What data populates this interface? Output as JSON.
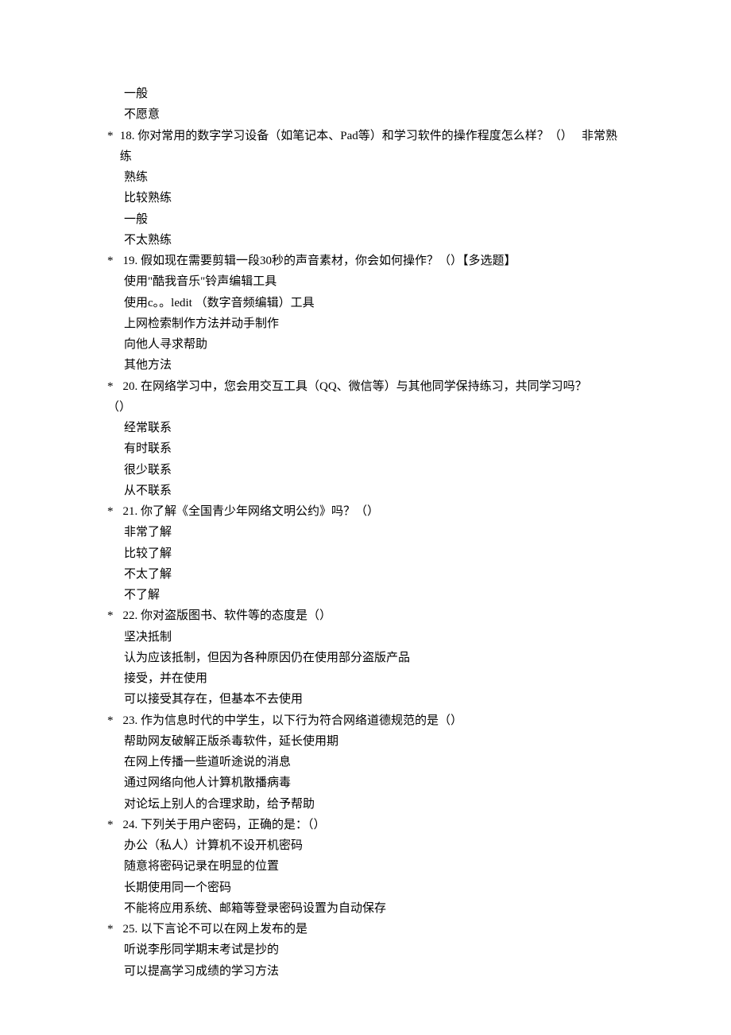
{
  "orphan_options": [
    "一般",
    "不愿意"
  ],
  "questions": [
    {
      "num": "18.",
      "text": "你对常用的数字学习设备（如笔记本、Pad等）和学习软件的操作程度怎么样？（）",
      "inline_option": "非常熟练",
      "options": [
        "熟练",
        "比较熟练",
        "一般",
        "不太熟练"
      ],
      "spaced": false
    },
    {
      "num": "19.",
      "text": "假如现在需要剪辑一段30秒的声音素材，你会如何操作？（）【多选题】",
      "inline_option": null,
      "options": [
        "使用\"酷我音乐\"铃声编辑工具",
        "使用c。。ledit （数字音频编辑）工具",
        "上网检索制作方法并动手制作",
        "向他人寻求帮助",
        "其他方法"
      ],
      "spaced": true
    },
    {
      "num": "20.",
      "text": "在网络学习中，您会用交互工具（QQ、微信等）与其他同学保持练习，共同学习吗？",
      "inline_option": null,
      "line2": "（）",
      "options": [
        "经常联系",
        "有时联系",
        "很少联系",
        "从不联系"
      ],
      "spaced": true
    },
    {
      "num": "21.",
      "text": "你了解《全国青少年网络文明公约》吗？（）",
      "inline_option": null,
      "options": [
        "非常了解",
        "比较了解",
        "不太了解",
        "不了解"
      ],
      "spaced": true
    },
    {
      "num": "22.",
      "text": "你对盗版图书、软件等的态度是（）",
      "inline_option": null,
      "options": [
        "坚决抵制",
        "认为应该抵制，但因为各种原因仍在使用部分盗版产品",
        "接受，并在使用",
        "可以接受其存在，但基本不去使用"
      ],
      "spaced": true
    },
    {
      "num": "23.",
      "text": "作为信息时代的中学生，以下行为符合网络道德规范的是（）",
      "inline_option": null,
      "options": [
        "帮助网友破解正版杀毒软件，延长使用期",
        "在网上传播一些道听途说的消息",
        "通过网络向他人计算机散播病毒",
        "对论坛上别人的合理求助，给予帮助"
      ],
      "spaced": true
    },
    {
      "num": "24.",
      "text": "下列关于用户密码，正确的是：（）",
      "inline_option": null,
      "options": [
        "办公（私人）计算机不设开机密码",
        "随意将密码记录在明显的位置",
        "长期使用同一个密码",
        "不能将应用系统、邮箱等登录密码设置为自动保存"
      ],
      "spaced": true
    },
    {
      "num": "25.",
      "text": "以下言论不可以在网上发布的是",
      "inline_option": null,
      "options": [
        "听说李彤同学期末考试是抄的",
        "可以提高学习成绩的学习方法"
      ],
      "spaced": true
    }
  ]
}
